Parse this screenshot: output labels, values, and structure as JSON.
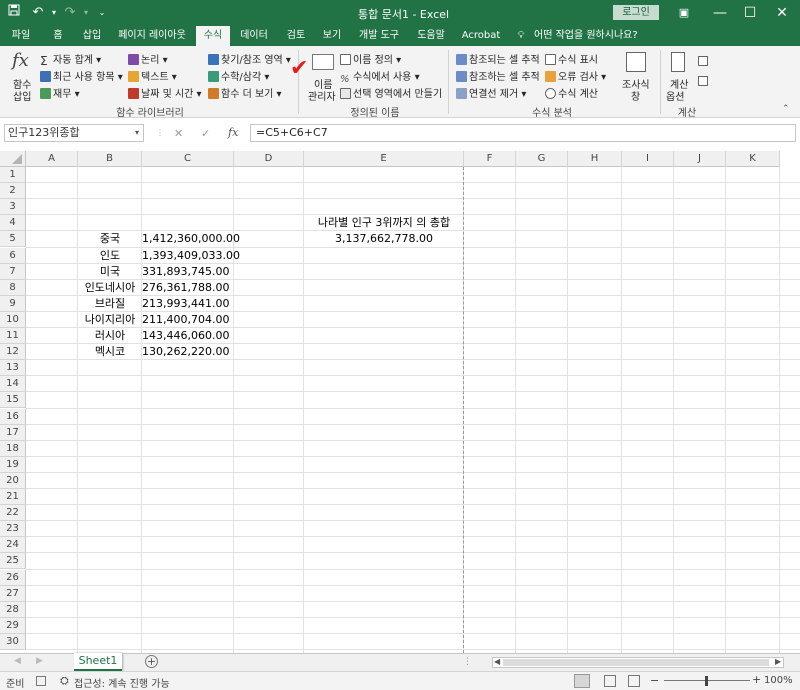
{
  "title_bar": {
    "document_title": "통합 문서1  -  Excel",
    "login_label": "로그인",
    "qat": {
      "save_icon": "save-icon",
      "undo_icon": "undo-icon",
      "redo_icon": "redo-icon"
    }
  },
  "tabs": [
    "파일",
    "홈",
    "삽입",
    "페이지 레이아웃",
    "수식",
    "데이터",
    "검토",
    "보기",
    "개발 도구",
    "도움말",
    "Acrobat"
  ],
  "active_tab": "수식",
  "tell_me": "어떤 작업을 원하시나요?",
  "ribbon": {
    "insert_function": "함수\n삽입",
    "insert_function_l1": "함수",
    "insert_function_l2": "삽입",
    "autosum": "자동 합계",
    "recent": "최근 사용 항목",
    "financial": "재무",
    "logical": "논리",
    "text": "텍스트",
    "datetime": "날짜 및 시간",
    "lookup": "찾기/참조 영역",
    "math": "수학/삼각",
    "more": "함수 더 보기",
    "group_library": "함수 라이브러리",
    "name_manager_l1": "이름",
    "name_manager_l2": "관리자",
    "define_name": "이름 정의",
    "use_in_formula": "수식에서 사용",
    "create_from_sel": "선택 영역에서 만들기",
    "group_names": "정의된 이름",
    "trace_precedents": "참조되는 셀 추적",
    "trace_dependents": "참조하는 셀 추적",
    "remove_arrows": "연결선 제거",
    "show_formulas": "수식 표시",
    "error_check": "오류 검사",
    "evaluate": "수식 계산",
    "watch_l1": "조사식",
    "watch_l2": "창",
    "group_audit": "수식 분석",
    "calc_options_l1": "계산",
    "calc_options_l2": "옵션",
    "group_calc": "계산"
  },
  "formula_bar": {
    "name_box": "인구123위종합",
    "cancel_icon": "✕",
    "enter_icon": "✓",
    "fx": "fx",
    "formula": "=C5+C6+C7"
  },
  "columns": [
    "A",
    "B",
    "C",
    "D",
    "E",
    "F",
    "G",
    "H",
    "I",
    "J",
    "K"
  ],
  "rows": [
    "1",
    "2",
    "3",
    "4",
    "5",
    "6",
    "7",
    "8",
    "9",
    "10",
    "11",
    "12",
    "13",
    "14",
    "15",
    "16",
    "17",
    "18",
    "19",
    "20",
    "21",
    "22",
    "23",
    "24",
    "25",
    "26",
    "27",
    "28",
    "29",
    "30"
  ],
  "cells": {
    "E4": "나라별 인구 3위까지 의 총합",
    "E5": "3,137,662,778.00",
    "countries": [
      "중국",
      "인도",
      "미국",
      "인도네시아",
      "브라질",
      "나이지리아",
      "러시아",
      "멕시코"
    ],
    "populations": [
      "1,412,360,000.00",
      "1,393,409,033.00",
      "331,893,745.00",
      "276,361,788.00",
      "213,993,441.00",
      "211,400,704.00",
      "143,446,060.00",
      "130,262,220.00"
    ]
  },
  "sheet_tab": "Sheet1",
  "status": {
    "ready": "준비",
    "accessibility": "접근성: 계속 진행 가능",
    "zoom": "100%"
  },
  "colors": {
    "brand": "#217346",
    "checkmark": "#e0201b"
  }
}
